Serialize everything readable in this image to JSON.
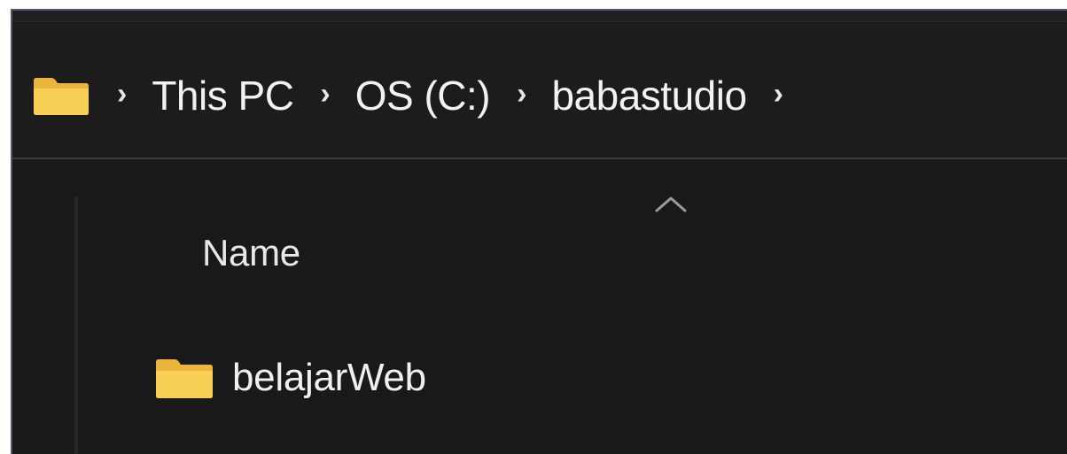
{
  "breadcrumb": {
    "items": [
      {
        "label": "This PC"
      },
      {
        "label": "OS (C:)"
      },
      {
        "label": "babastudio"
      }
    ],
    "separator": "›"
  },
  "file_list": {
    "column_header": "Name",
    "sort_indicator": "ascending",
    "rows": [
      {
        "name": "belajarWeb",
        "type": "folder"
      }
    ]
  },
  "colors": {
    "background": "#191919",
    "folder_yellow": "#f6c94a",
    "text": "#f0f0f0"
  },
  "icons": {
    "address_icon": "folder-icon",
    "row_icon": "folder-icon",
    "sort_icon": "chevron-up-icon"
  }
}
